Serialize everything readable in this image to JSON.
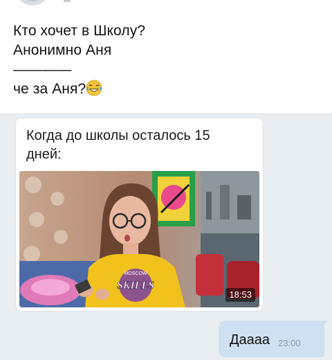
{
  "post": {
    "lines": [
      "Кто хочет в Школу?",
      "Анонимно Аня",
      "————",
      "че за Аня?"
    ],
    "emoji_icon": "face-with-tears-of-joy-emoji"
  },
  "message_card": {
    "text": "Когда до школы осталось 15 дней:",
    "video": {
      "duration": "18:53",
      "shirt_text": "SKILLS",
      "shirt_small_text": "MOSCOW"
    }
  },
  "reply": {
    "text": "Даааа",
    "time": "23:00"
  },
  "colors": {
    "background": "#e9eef3",
    "bubble": "#cfe0f2",
    "time": "#8c9aa8"
  }
}
